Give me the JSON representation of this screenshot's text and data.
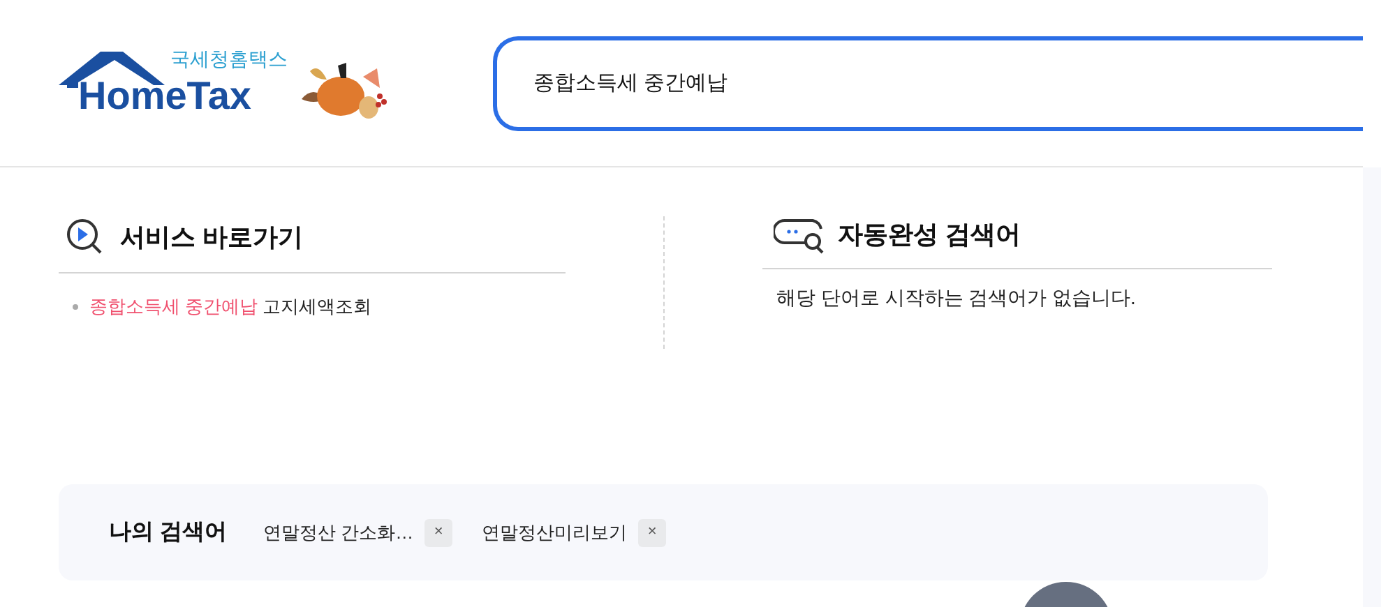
{
  "logo": {
    "subtitle": "국세청홈택스",
    "title": "HomeTax"
  },
  "search": {
    "value": "종합소득세 중간예납"
  },
  "shortcuts": {
    "title": "서비스 바로가기",
    "items": [
      {
        "highlight": "종합소득세 중간예납",
        "rest": "고지세액조회"
      }
    ]
  },
  "autocomplete": {
    "title": "자동완성 검색어",
    "message": "해당 단어로 시작하는 검색어가 없습니다."
  },
  "my_searches": {
    "title": "나의 검색어",
    "items": [
      {
        "label": "연말정산 간소화…",
        "remove": "×"
      },
      {
        "label": "연말정산미리보기",
        "remove": "×"
      }
    ]
  }
}
